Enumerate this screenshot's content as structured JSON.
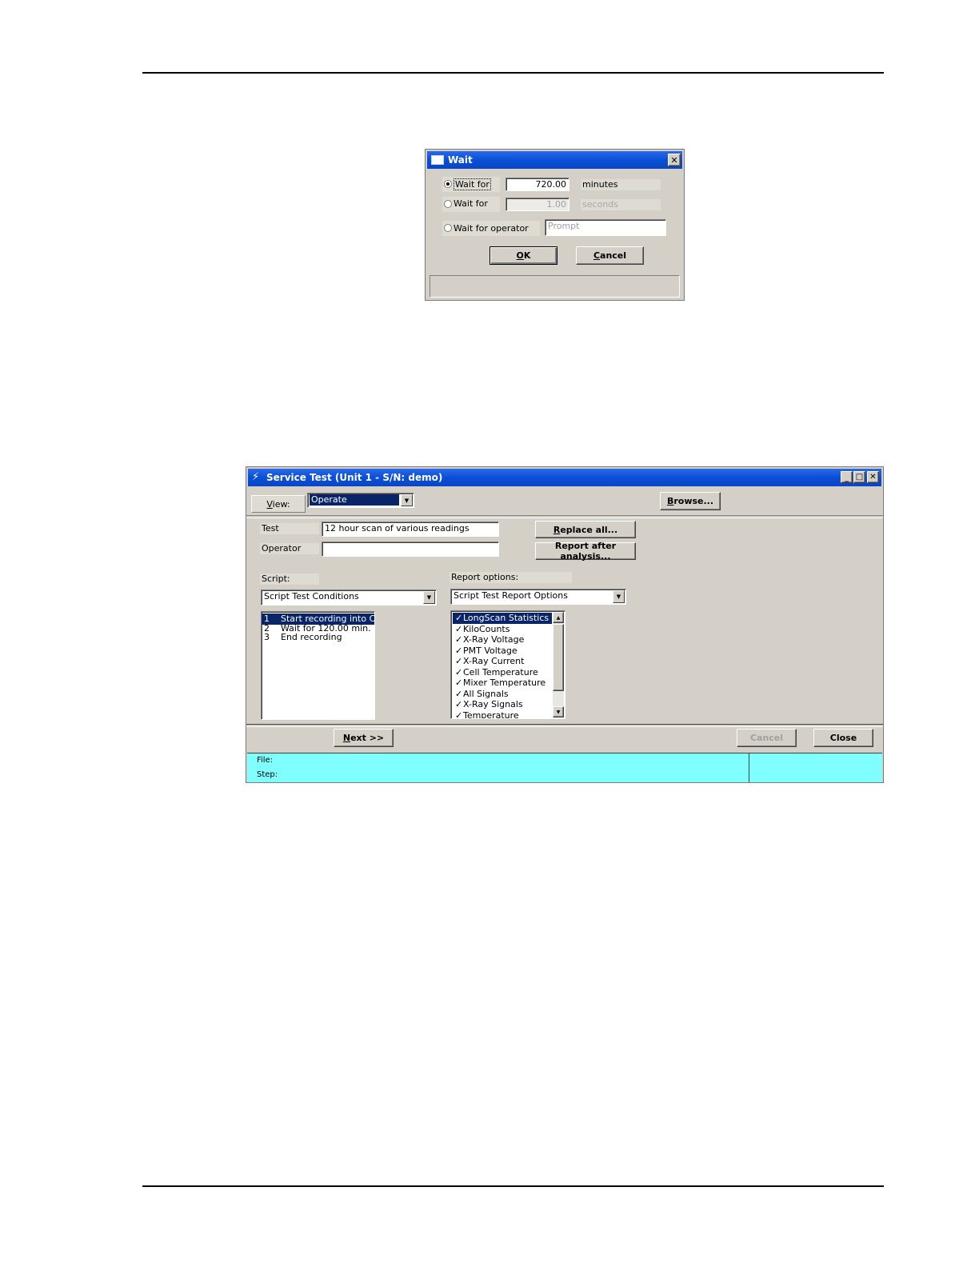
{
  "wait_dialog": {
    "title": "Wait",
    "option_minutes": {
      "label": "Wait for",
      "value": "720.00",
      "unit": "minutes",
      "checked": true
    },
    "option_seconds": {
      "label": "Wait for",
      "value": "1.00",
      "unit": "seconds",
      "checked": false
    },
    "option_operator": {
      "label": "Wait for operator",
      "placeholder": "Prompt",
      "checked": false
    },
    "ok_label": "OK",
    "cancel_label": "Cancel",
    "close_glyph": "✕"
  },
  "service_test": {
    "title": "Service Test (Unit 1 - S/N: demo)",
    "view_label": "View:",
    "view_value": "Operate",
    "browse_label": "Browse...",
    "test_label": "Test",
    "test_value": "12 hour scan of various readings",
    "operator_label": "Operator",
    "operator_value": "",
    "replace_all_label": "Replace all...",
    "report_after_label": "Report after analysis...",
    "script_label": "Script:",
    "script_combo": "Script Test Conditions",
    "script_steps": [
      {
        "num": "1",
        "text": "Start recording into Co",
        "selected": true
      },
      {
        "num": "2",
        "text": "Wait for 120.00 min.",
        "selected": false
      },
      {
        "num": "3",
        "text": "End recording",
        "selected": false
      }
    ],
    "report_options_label": "Report options:",
    "report_combo": "Script Test Report Options",
    "report_items": [
      {
        "check": "✓",
        "text": "LongScan Statistics",
        "selected": true
      },
      {
        "check": "✓",
        "text": "KiloCounts",
        "selected": false
      },
      {
        "check": "✓",
        "text": "X-Ray Voltage",
        "selected": false
      },
      {
        "check": "✓",
        "text": "PMT Voltage",
        "selected": false
      },
      {
        "check": "✓",
        "text": "X-Ray Current",
        "selected": false
      },
      {
        "check": "✓",
        "text": "Cell Temperature",
        "selected": false
      },
      {
        "check": "✓",
        "text": "Mixer Temperature",
        "selected": false
      },
      {
        "check": "✓",
        "text": "All Signals",
        "selected": false
      },
      {
        "check": "✓",
        "text": "X-Ray Signals",
        "selected": false
      },
      {
        "check": "✓",
        "text": "Temperature",
        "selected": false
      }
    ],
    "next_label": "Next >>",
    "cancel_label": "Cancel",
    "close_label": "Close",
    "status_file_label": "File:",
    "status_step_label": "Step:",
    "status_color": "#80ffff",
    "title_color": "#0a4fd8"
  }
}
